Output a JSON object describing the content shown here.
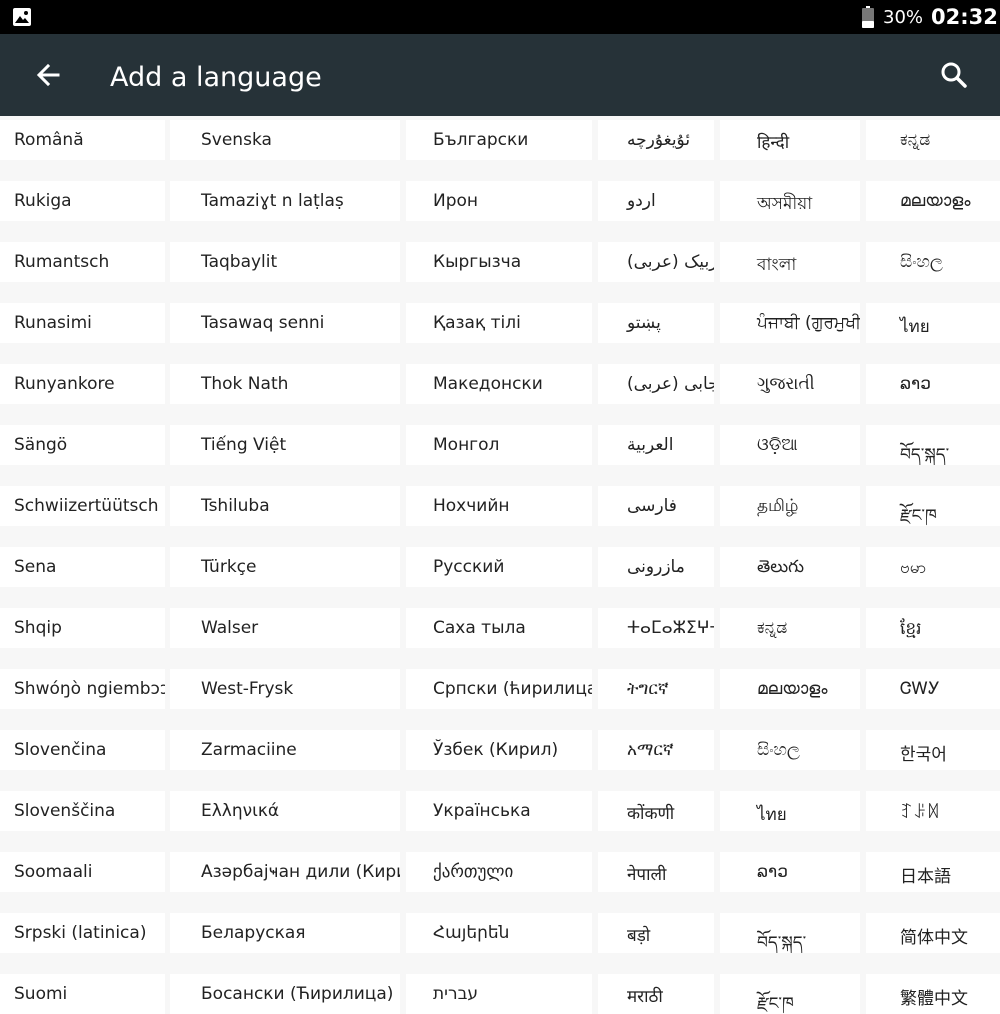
{
  "status_bar": {
    "battery": "30%",
    "time": "02:32"
  },
  "app_bar": {
    "title": "Add a language"
  },
  "columns": [
    [
      "Română",
      "Rukiga",
      "Rumantsch",
      "Runasimi",
      "Runyankore",
      "Sängö",
      "Schwiizertüütsch",
      "Sena",
      "Shqip",
      "Shwóŋò ngiembɔɔn",
      "Slovenčina",
      "Slovenščina",
      "Soomaali",
      "Srpski (latinica)",
      "Suomi"
    ],
    [
      "Svenska",
      "Tamaziɣt n laṭlaṣ",
      "Taqbaylit",
      "Tasawaq senni",
      "Thok Nath",
      "Tiếng Việt",
      "Tshiluba",
      "Türkçe",
      "Walser",
      "West-Frysk",
      "Zarmaciine",
      "Ελληνικά",
      "Азәрбајҹан дили (Кирил)",
      "Беларуская",
      "Босански (Ћирилица)"
    ],
    [
      "Български",
      "Ирон",
      "Кыргызча",
      "Қазақ тілі",
      "Македонски",
      "Монгол",
      "Нохчийн",
      "Русский",
      "Саха тыла",
      "Српски (ћирилица)",
      "Ўзбек (Кирил)",
      "Українська",
      "ქართული",
      "Հայերեն",
      "עברית"
    ],
    [
      "ئۇيغۇرچە",
      "اردو",
      "اوزبیک (عربی)",
      "پښتو",
      "پنجابی (عربی)",
      "العربية",
      "فارسی",
      "مازرونی",
      "ⵜⴰⵎⴰⵣⵉⵖⵜ",
      "ትግርኛ",
      "አማርኛ",
      "कोंकणी",
      "नेपाली",
      "बड़ो",
      "मराठी"
    ],
    [
      "हिन्दी",
      "অসমীয়া",
      "বাংলা",
      "ਪੰਜਾਬੀ (ਗੁਰਮੁਖੀ)",
      "ગુજરાતી",
      "ଓଡ଼ିଆ",
      "தமிழ்",
      "తెలుగు",
      "ಕನ್ನಡ",
      "മലയാളം",
      "සිංහල",
      "ไทย",
      "ລາວ",
      "བོད་སྐད་",
      "རྫོང་ཁ"
    ],
    [
      "ಕನ್ನಡ",
      "മലയാളം",
      "සිංහල",
      "ไทย",
      "ລາວ",
      "བོད་སྐད་",
      "རྫོང་ཁ",
      "ဗမာ",
      "ខ្មែរ",
      "ᏣᎳᎩ",
      "한국어",
      "ꆈꌠꉙ",
      "日本語",
      "简体中文",
      "繁體中文"
    ]
  ]
}
